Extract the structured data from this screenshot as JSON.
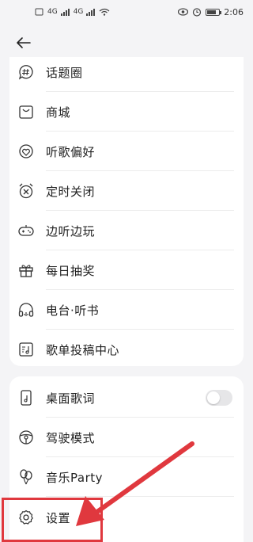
{
  "status_bar": {
    "network_left": "4G",
    "network_right": "4G",
    "time": "2:06"
  },
  "colors": {
    "background": "#f4f4f6",
    "card": "#ffffff",
    "icon_stroke": "#333333",
    "annotation": "#e0383e"
  },
  "menu_group_1": [
    {
      "label": "话题圈",
      "icon": "chat-hash-icon"
    },
    {
      "label": "商城",
      "icon": "shopping-bag-icon"
    },
    {
      "label": "听歌偏好",
      "icon": "music-preference-icon"
    },
    {
      "label": "定时关闭",
      "icon": "alarm-timer-icon"
    },
    {
      "label": "边听边玩",
      "icon": "gamepad-icon"
    },
    {
      "label": "每日抽奖",
      "icon": "gift-icon"
    },
    {
      "label": "电台·听书",
      "icon": "headphones-icon"
    },
    {
      "label": "歌单投稿中心",
      "icon": "playlist-submit-icon"
    }
  ],
  "menu_group_2": [
    {
      "label": "桌面歌词",
      "icon": "phone-lyrics-icon",
      "toggle": false
    },
    {
      "label": "驾驶模式",
      "icon": "steering-wheel-icon"
    },
    {
      "label": "音乐Party",
      "icon": "balloons-icon"
    },
    {
      "label": "设置",
      "icon": "gear-icon"
    }
  ]
}
